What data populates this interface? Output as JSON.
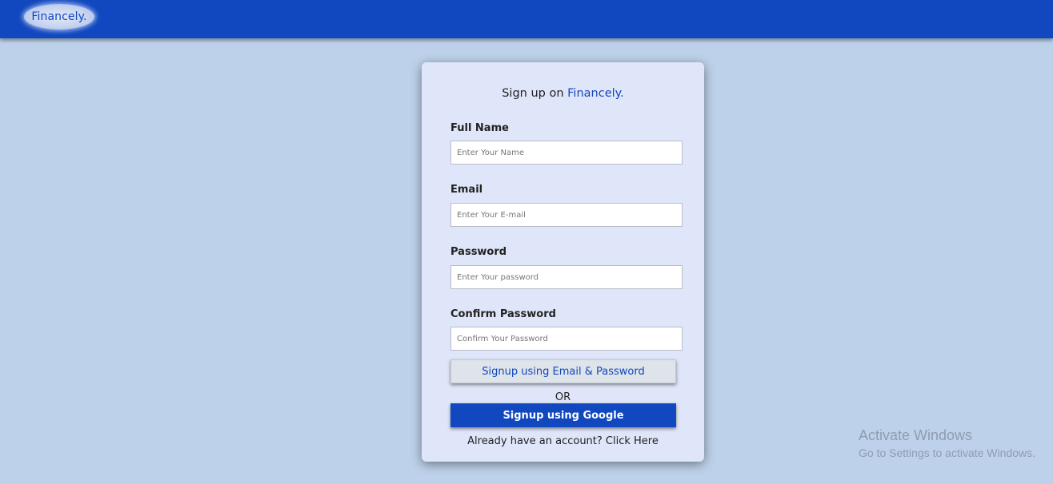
{
  "header": {
    "logo_text": "Financely."
  },
  "signup": {
    "title_prefix": "Sign up on ",
    "title_brand": "Financely.",
    "fields": [
      {
        "label": "Full Name",
        "placeholder": "Enter Your Name",
        "value": ""
      },
      {
        "label": "Email",
        "placeholder": "Enter Your E-mail",
        "value": ""
      },
      {
        "label": "Password",
        "placeholder": "Enter Your password",
        "value": ""
      },
      {
        "label": "Confirm Password",
        "placeholder": "Confirm Your Password",
        "value": ""
      }
    ],
    "email_button_label": "Signup using Email & Password",
    "or_text": "OR",
    "google_button_label": "Signup using Google",
    "login_prompt": "Already have an account? ",
    "login_link": "Click Here"
  },
  "watermark": {
    "title": "Activate Windows",
    "subtitle": "Go to Settings to activate Windows."
  },
  "colors": {
    "brand": "#1148bf",
    "page_background": "#bdd2ea",
    "card_background": "#e0e6f9"
  }
}
